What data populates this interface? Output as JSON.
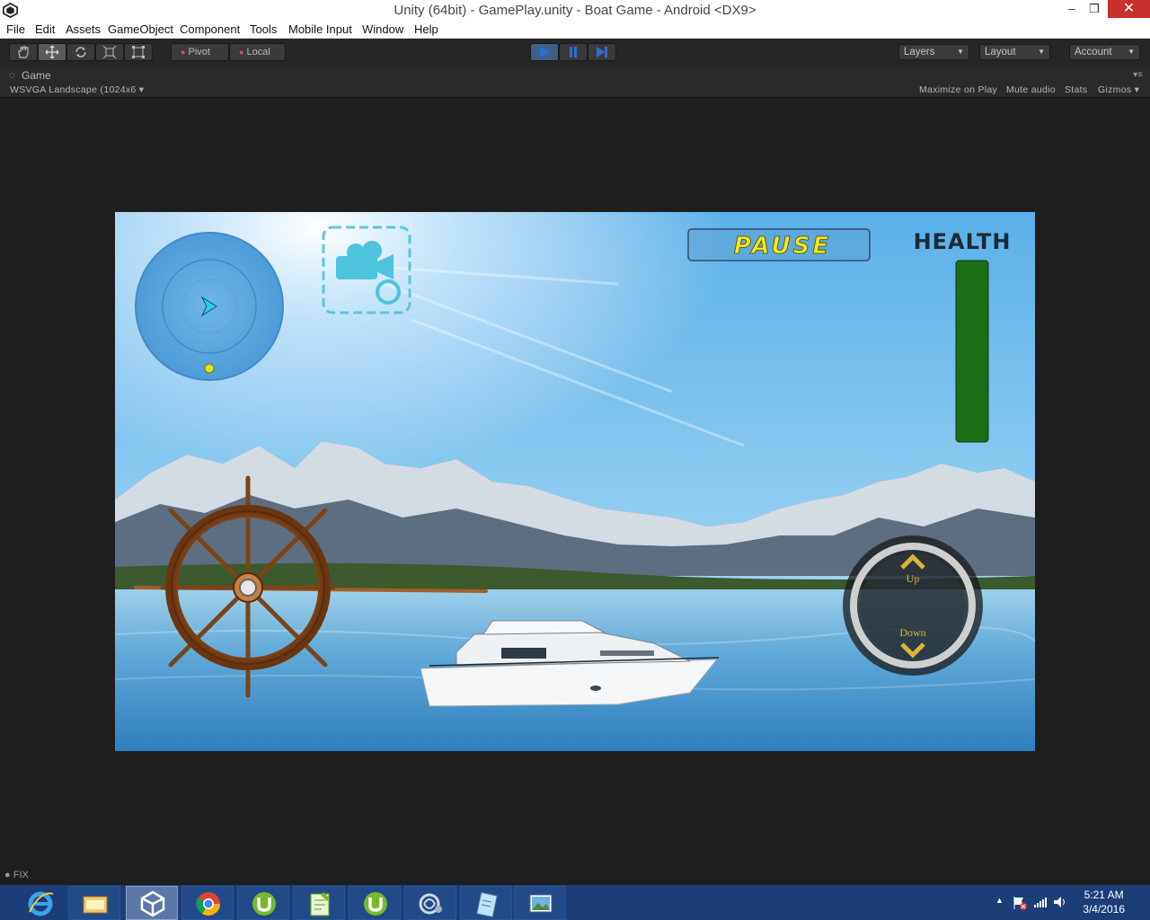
{
  "window": {
    "title": "Unity (64bit) - GamePlay.unity - Boat Game - Android <DX9>",
    "minimize": "–",
    "restore": "❐",
    "close": "✕"
  },
  "menu": {
    "items": [
      "File",
      "Edit",
      "Assets",
      "GameObject",
      "Component",
      "Tools",
      "Mobile Input",
      "Window",
      "Help"
    ]
  },
  "toolbar": {
    "pivot_label": "Pivot",
    "local_label": "Local",
    "layers_label": "Layers",
    "layout_label": "Layout",
    "account_label": "Account"
  },
  "game_tab": {
    "title": "Game",
    "aspect": "WSVGA Landscape (1024x6",
    "maximize_on_play": "Maximize on Play",
    "mute_audio": "Mute audio",
    "stats": "Stats",
    "gizmos": "Gizmos"
  },
  "game_ui": {
    "pause_label": "PAUSE",
    "health_label": "HEALTH",
    "health_level": 1.0,
    "up_label": "Up",
    "down_label": "Down"
  },
  "status": {
    "text": "FIX"
  },
  "taskbar": {
    "apps": [
      "internet-explorer",
      "file-explorer",
      "unity",
      "chrome",
      "utorrent",
      "notepad-plus-plus",
      "utorrent",
      "network-tool",
      "notepad",
      "photo-viewer"
    ],
    "time": "5:21 AM",
    "date": "3/4/2016"
  },
  "colors": {
    "accent_blue": "#2a6fd6",
    "health_green": "#1a6e13",
    "pause_yellow": "#f5e51c",
    "sky_blue": "#4fa8e6"
  }
}
